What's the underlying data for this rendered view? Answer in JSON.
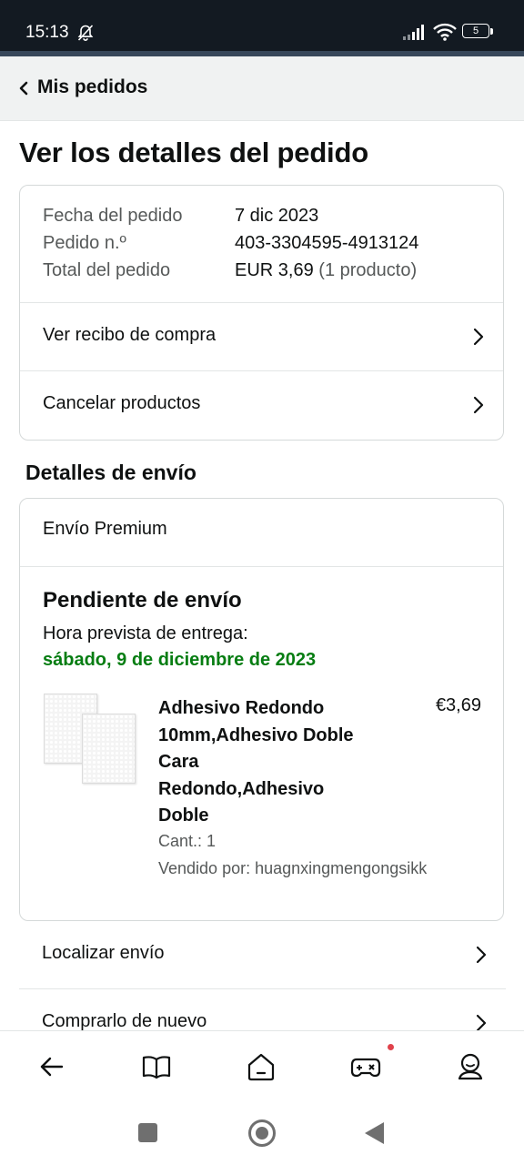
{
  "status_bar": {
    "time": "15:13",
    "battery": "5",
    "icons": [
      "bell-off-icon",
      "signal-icon",
      "wifi-icon",
      "battery-icon"
    ]
  },
  "header": {
    "back_label": "Mis pedidos"
  },
  "page_title": "Ver los detalles del pedido",
  "order_summary": {
    "date_label": "Fecha del pedido",
    "date_value": "7 dic 2023",
    "number_label": "Pedido n.º",
    "number_value": "403-3304595-4913124",
    "total_label": "Total del pedido",
    "total_value": "EUR 3,69",
    "total_count": "(1 producto)",
    "receipt_link": "Ver recibo de compra",
    "cancel_link": "Cancelar productos"
  },
  "shipping": {
    "section_title": "Detalles de envío",
    "shipping_type": "Envío Premium",
    "status": "Pendiente de envío",
    "eta_label": "Hora prevista de entrega:",
    "eta_date": "sábado, 9 de diciembre de 2023",
    "item": {
      "title": "Adhesivo Redondo 10mm,Adhesivo Doble Cara Redondo,Adhesivo Doble",
      "price": "€3,69",
      "quantity": "Cant.: 1",
      "seller": "Vendido por: huagnxingmengongsikk"
    }
  },
  "actions": {
    "track": "Localizar envío",
    "buy_again": "Comprarlo de nuevo"
  },
  "bottom_nav": [
    "back-arrow-icon",
    "book-icon",
    "home-icon",
    "gamepad-icon",
    "profile-icon"
  ],
  "colors": {
    "eta_green": "#067d12",
    "status_bar": "#131a22",
    "header_bg": "#f0f2f2",
    "badge_red": "#e0424b"
  }
}
